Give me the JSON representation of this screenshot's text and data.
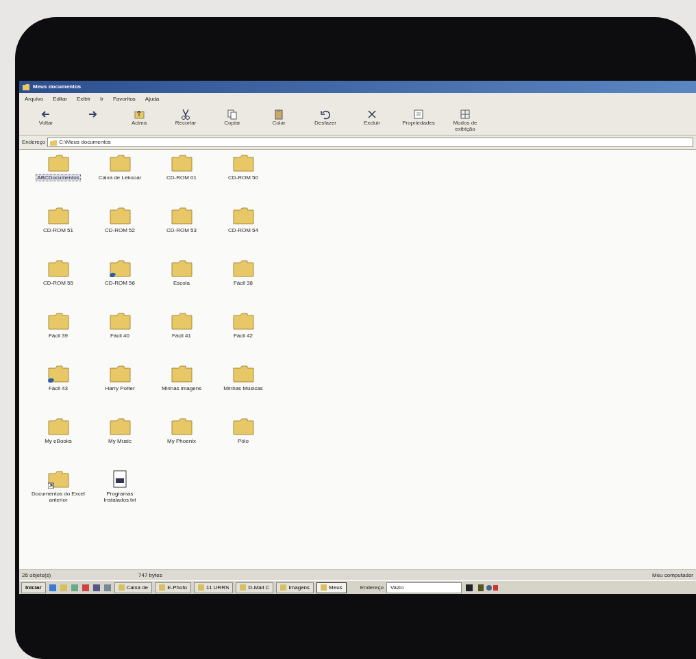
{
  "window": {
    "title": "Meus documentos"
  },
  "menu": [
    "Arquivo",
    "Editar",
    "Exibir",
    "Ir",
    "Favoritos",
    "Ajuda"
  ],
  "toolbar": [
    {
      "label": "Voltar",
      "kind": "back"
    },
    {
      "kind": "forward"
    },
    {
      "label": "Acima",
      "kind": "up"
    },
    {
      "label": "Recortar",
      "kind": "cut"
    },
    {
      "label": "Copiar",
      "kind": "copy"
    },
    {
      "label": "Colar",
      "kind": "paste"
    },
    {
      "label": "Desfazer",
      "kind": "undo"
    },
    {
      "label": "Excluir",
      "kind": "delete"
    },
    {
      "label": "Propriedades",
      "kind": "properties"
    },
    {
      "label": "Modos de exibição",
      "kind": "views"
    }
  ],
  "address": {
    "label": "Endereço",
    "value": "C:\\Meus documentos"
  },
  "items": [
    {
      "name": "ABCDocumentos",
      "kind": "folder",
      "selected": true
    },
    {
      "name": "Caixa de Lekooar",
      "kind": "folder",
      "selected": false
    },
    {
      "name": "CD-ROM 01",
      "kind": "folder",
      "selected": false
    },
    {
      "name": "CD-ROM 50",
      "kind": "folder",
      "selected": false
    },
    {
      "name": "CD-ROM 51",
      "kind": "folder",
      "selected": false
    },
    {
      "name": "CD-ROM 52",
      "kind": "folder",
      "selected": false
    },
    {
      "name": "CD-ROM 53",
      "kind": "folder",
      "selected": false
    },
    {
      "name": "CD-ROM 54",
      "kind": "folder",
      "selected": false
    },
    {
      "name": "CD-ROM 55",
      "kind": "folder",
      "selected": false
    },
    {
      "name": "CD-ROM 56",
      "kind": "shared",
      "selected": false
    },
    {
      "name": "Escola",
      "kind": "folder",
      "selected": false
    },
    {
      "name": "Fácil 38",
      "kind": "folder",
      "selected": false
    },
    {
      "name": "Fácil 39",
      "kind": "folder",
      "selected": false
    },
    {
      "name": "Fácil 40",
      "kind": "folder",
      "selected": false
    },
    {
      "name": "Fácil 41",
      "kind": "folder",
      "selected": false
    },
    {
      "name": "Fácil 42",
      "kind": "folder",
      "selected": false
    },
    {
      "name": "Fácil 43",
      "kind": "shared",
      "selected": false
    },
    {
      "name": "Harry Potter",
      "kind": "folder",
      "selected": false
    },
    {
      "name": "Minhas imagens",
      "kind": "folder",
      "selected": false
    },
    {
      "name": "Minhas Músicas",
      "kind": "folder",
      "selected": false
    },
    {
      "name": "My eBooks",
      "kind": "folder",
      "selected": false
    },
    {
      "name": "My Music",
      "kind": "folder",
      "selected": false
    },
    {
      "name": "My Phoenix",
      "kind": "folder",
      "selected": false
    },
    {
      "name": "Pólo",
      "kind": "folder",
      "selected": false
    },
    {
      "name": "Documentos do Excel anterior",
      "kind": "shortcut",
      "selected": false
    },
    {
      "name": "Programas Instalados.txt",
      "kind": "file",
      "selected": false
    }
  ],
  "status_bar": [
    "26 objeto(s)",
    "747 bytes",
    "Meu computador"
  ],
  "taskbar": {
    "start": "Iniciar",
    "tasks": [
      {
        "label": "Caixa de",
        "selected": false
      },
      {
        "label": "E-Photo",
        "selected": false
      },
      {
        "label": "11 URRS",
        "selected": false
      },
      {
        "label": "D-Mail C",
        "selected": false
      },
      {
        "label": "Imagens",
        "selected": false
      },
      {
        "label": "Meus",
        "selected": true
      }
    ],
    "address_label": "Endereço",
    "address_value": "Vazio"
  }
}
